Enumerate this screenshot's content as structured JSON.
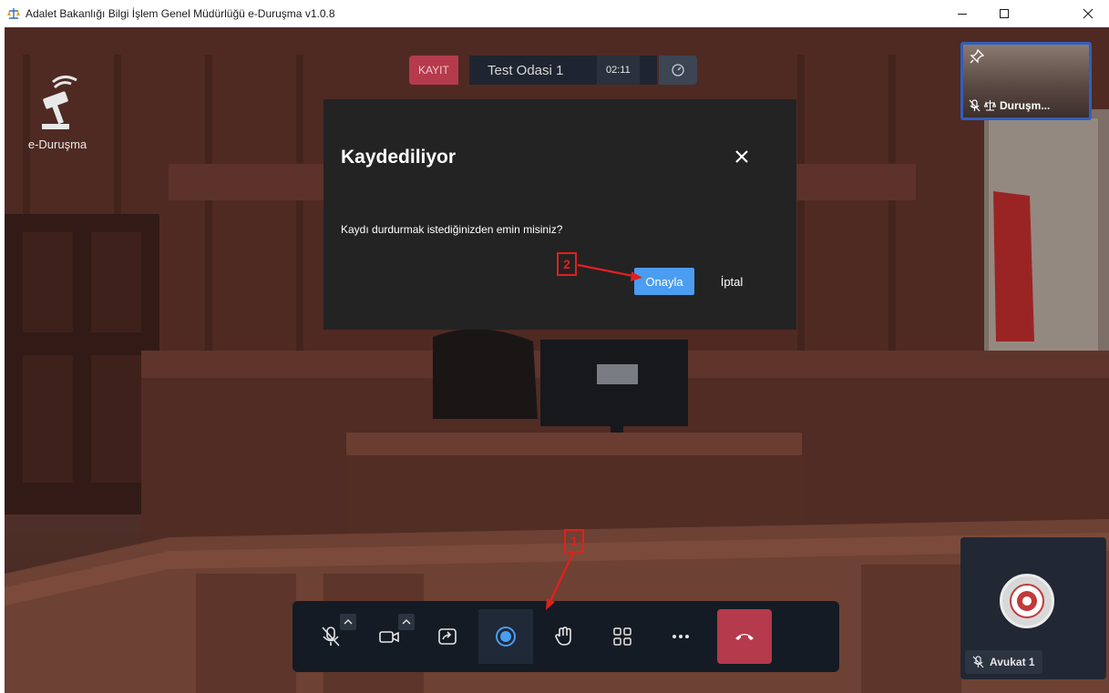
{
  "window": {
    "title": "Adalet Bakanlığı Bilgi İşlem Genel Müdürlüğü e-Duruşma v1.0.8",
    "icon": "scales-icon",
    "controls": [
      "minimize-icon",
      "maximize-icon",
      "close-icon"
    ]
  },
  "logo": {
    "text": "e-Duruşma",
    "icon": "gavel-icon"
  },
  "status": {
    "record_badge": "KAYIT",
    "room_name": "Test Odasi 1",
    "timer": "02:11",
    "speed_icon": "gauge-icon"
  },
  "thumbnail": {
    "label": "Duruşm...",
    "pin_icon": "pin-icon",
    "mic_icon": "mic-off-icon",
    "role_icon": "scales-icon"
  },
  "self_view": {
    "label": "Avukat 1",
    "mic_icon": "mic-off-icon",
    "avatar_icon": "seal-icon"
  },
  "toolbar": {
    "buttons": [
      "mic-off-icon",
      "camera-icon",
      "screen-share-icon",
      "record-icon",
      "raise-hand-icon",
      "grid-view-icon",
      "more-icon",
      "hang-up-icon"
    ],
    "active": "record-icon"
  },
  "modal": {
    "title": "Kaydediliyor",
    "message": "Kaydı durdurmak istediğinizden emin misiniz?",
    "confirm_label": "Onayla",
    "cancel_label": "İptal"
  },
  "annotations": {
    "step_1": "1",
    "step_2": "2"
  },
  "colors": {
    "record_red": "#b53a4b",
    "confirm_blue": "#4a9df0",
    "modal_bg": "#232323",
    "toolbar_bg": "#151b24",
    "annotation_red": "#e02020"
  }
}
